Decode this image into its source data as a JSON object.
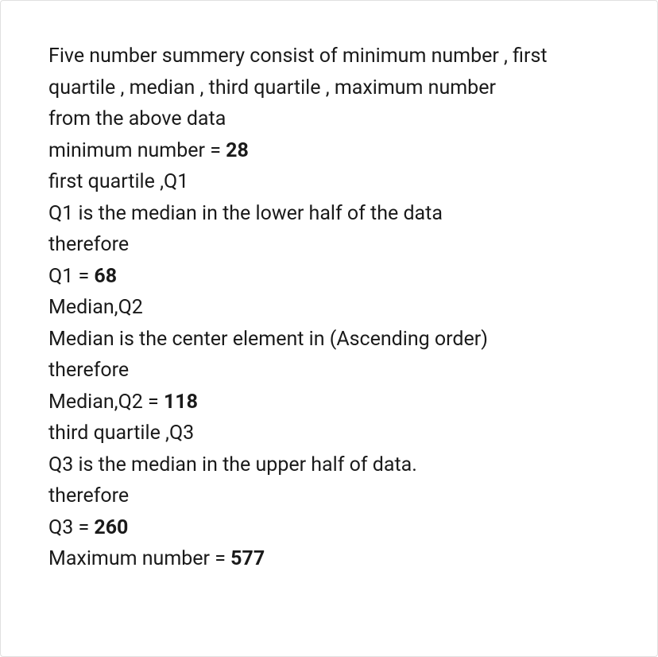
{
  "lines": {
    "l1": "Five number summery consist of minimum number , first quartile , median , third quartile , maximum number",
    "l2": "from the above data",
    "l3a": "minimum number = ",
    "l3b": "28",
    "l4": "first quartile ,Q1",
    "l5": "Q1 is the median in the lower half of the data",
    "l6": "therefore",
    "l7a": "Q1 = ",
    "l7b": "68",
    "l8": "Median,Q2",
    "l9": "Median is the center element in (Ascending order)",
    "l10": "therefore",
    "l11a": "Median,Q2 = ",
    "l11b": "118",
    "l12": "third quartile ,Q3",
    "l13": "Q3 is the median in the upper half of data.",
    "l14": "therefore",
    "l15a": "Q3 = ",
    "l15b": "260",
    "l16a": "Maximum number = ",
    "l16b": "577"
  }
}
